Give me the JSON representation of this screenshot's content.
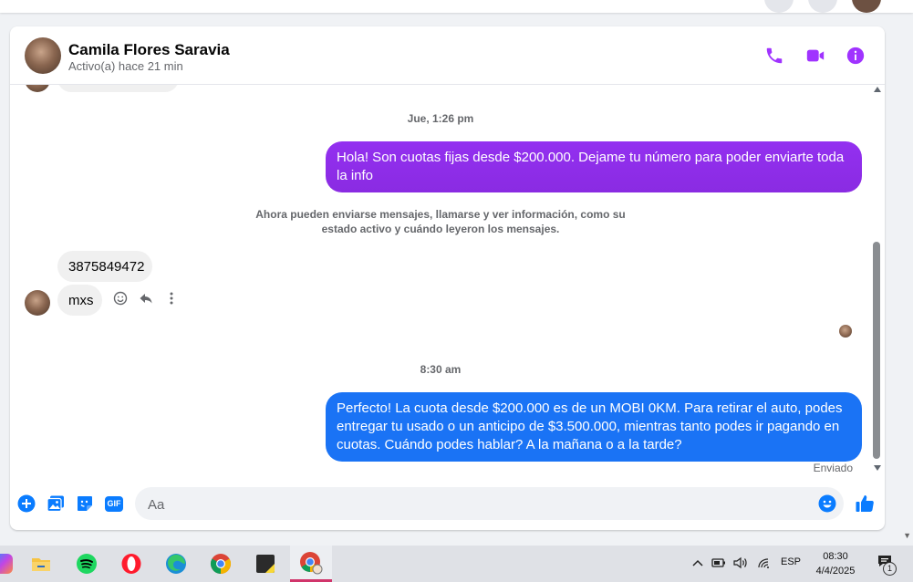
{
  "header": {
    "name": "Camila Flores Saravia",
    "status": "Activo(a) hace 21 min",
    "accent": "#a033ff"
  },
  "messages": {
    "ts1": "Jue, 1:26 pm",
    "out1": "Hola! Son cuotas fijas desde $200.000. Dejame tu número para poder enviarte toda la info",
    "system": "Ahora pueden enviarse mensajes, llamarse y ver información, como su estado activo y cuándo leyeron los mensajes.",
    "in1": "3875849472",
    "in2": "mxs",
    "ts2": "8:30 am",
    "out2": "Perfecto! La cuota desde $200.000 es de un MOBI 0KM. Para retirar el auto, podes entregar tu usado o un anticipo de $3.500.000, mientras tanto podes ir pagando en cuotas. Cuándo podes hablar? A la mañana o a la tarde?",
    "sent_status": "Enviado"
  },
  "composer": {
    "placeholder": "Aa",
    "gif_label": "GIF"
  },
  "taskbar": {
    "apps": [
      "copilot-icon",
      "file-explorer-icon",
      "spotify-icon",
      "opera-icon",
      "edge-icon",
      "chrome-icon",
      "sticky-notes-icon",
      "chrome-profile-icon"
    ],
    "lang": "ESP",
    "time": "08:30",
    "date": "4/4/2025",
    "notification_count": "1"
  },
  "colors": {
    "purple_bubble": "#8a2be2",
    "blue_bubble": "#1a73f5",
    "icon_accent": "#a033ff",
    "composer_accent": "#0a7cff"
  }
}
